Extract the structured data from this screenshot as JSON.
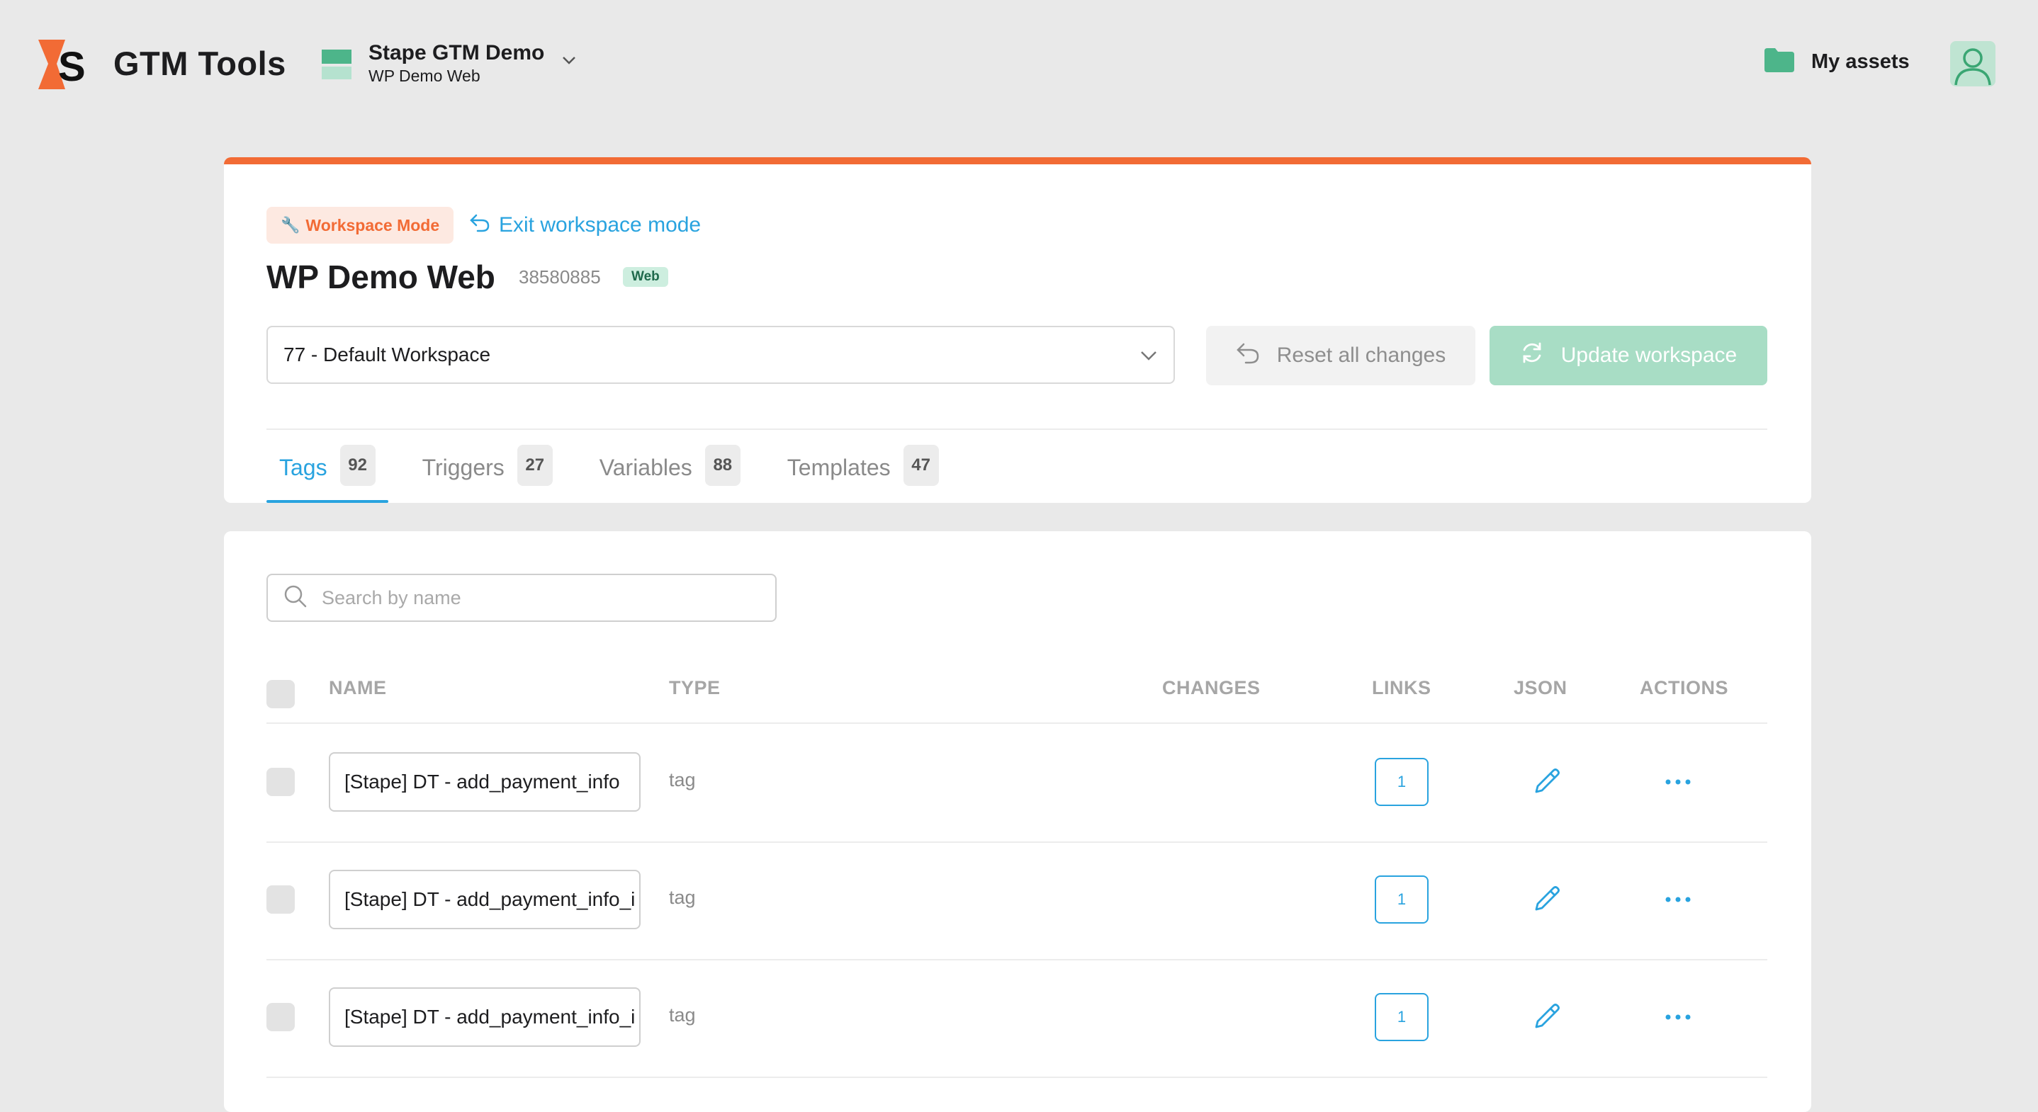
{
  "header": {
    "app_title": "GTM Tools",
    "container": {
      "name": "Stape GTM Demo",
      "subtitle": "WP Demo Web"
    },
    "my_assets_label": "My assets"
  },
  "workspace": {
    "mode_badge": "Workspace Mode",
    "exit_label": "Exit workspace mode",
    "title": "WP Demo Web",
    "container_id": "38580885",
    "type_badge": "Web",
    "selected_workspace": "77 - Default Workspace",
    "reset_label": "Reset all changes",
    "update_label": "Update workspace"
  },
  "tabs": [
    {
      "label": "Tags",
      "count": "92",
      "active": true
    },
    {
      "label": "Triggers",
      "count": "27",
      "active": false
    },
    {
      "label": "Variables",
      "count": "88",
      "active": false
    },
    {
      "label": "Templates",
      "count": "47",
      "active": false
    }
  ],
  "search": {
    "placeholder": "Search by name"
  },
  "table": {
    "columns": [
      "NAME",
      "TYPE",
      "CHANGES",
      "LINKS",
      "JSON",
      "ACTIONS"
    ],
    "rows": [
      {
        "name": "[Stape] DT - add_payment_info",
        "type": "tag",
        "changes": "",
        "links": "1"
      },
      {
        "name": "[Stape] DT - add_payment_info_i",
        "type": "tag",
        "changes": "",
        "links": "1"
      },
      {
        "name": "[Stape] DT - add_payment_info_i",
        "type": "tag",
        "changes": "",
        "links": "1"
      }
    ]
  },
  "colors": {
    "accent_orange": "#f26b35",
    "link_blue": "#29a3df",
    "brand_green": "#4db58a",
    "update_button_disabled": "#a8ddc5"
  },
  "icons": {
    "logo": "stape-logo",
    "container": "container-icon",
    "chevron": "chevron-down-icon",
    "assets": "folder-icon",
    "avatar": "user-avatar-icon",
    "exit": "undo-arrow-icon",
    "reset": "undo-arrow-icon",
    "update": "refresh-icon",
    "search": "search-icon",
    "json": "pencil-icon",
    "actions": "more-horizontal-icon"
  }
}
